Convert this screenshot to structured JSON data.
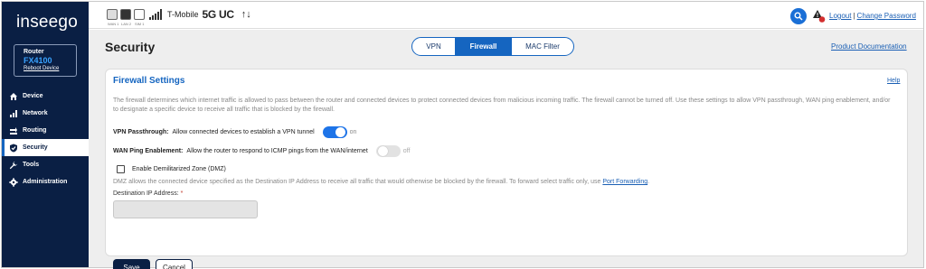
{
  "sidebar": {
    "logo": "inseego",
    "router_label": "Router",
    "router_model": "FX4100",
    "reboot_label": "Reboot Device",
    "items": [
      {
        "label": "Device",
        "icon": "home-icon"
      },
      {
        "label": "Network",
        "icon": "signal-bars-icon"
      },
      {
        "label": "Routing",
        "icon": "routing-icon"
      },
      {
        "label": "Security",
        "icon": "shield-icon",
        "active": true
      },
      {
        "label": "Tools",
        "icon": "wrench-icon"
      },
      {
        "label": "Administration",
        "icon": "gear-icon"
      }
    ]
  },
  "topbar": {
    "status_icon_labels": [
      "WAN 1",
      "LAN 2",
      "SIM 1"
    ],
    "carrier": "T-Mobile",
    "network_type": "5G UC",
    "data_arrows": "↑↓",
    "logout_label": "Logout",
    "separator": "|",
    "change_password_label": "Change Password"
  },
  "page": {
    "title": "Security",
    "tabs": [
      {
        "label": "VPN",
        "active": false
      },
      {
        "label": "Firewall",
        "active": true
      },
      {
        "label": "MAC Filter",
        "active": false
      }
    ],
    "product_doc_label": "Product Documentation"
  },
  "firewall": {
    "title": "Firewall Settings",
    "help_label": "Help",
    "description": "The firewall determines which internet traffic is allowed to pass between the router and connected devices to protect connected devices from malicious incoming traffic. The firewall cannot be turned off. Use these settings to allow VPN passthrough, WAN ping enablement, and/or to designate a specific device to receive all traffic that is blocked by the firewall.",
    "vpn_passthrough": {
      "label": "VPN Passthrough:",
      "desc": "Allow connected devices to establish a VPN tunnel",
      "state": "on"
    },
    "wan_ping": {
      "label": "WAN Ping Enablement:",
      "desc": "Allow the router to respond to ICMP pings from the WAN/internet",
      "state": "off"
    },
    "dmz": {
      "checkbox_label": "Enable Demilitarized Zone (DMZ)",
      "checked": false,
      "desc": "DMZ allows the connected device specified as the Destination IP Address to receive all traffic that would otherwise be blocked by the firewall. To forward select traffic only, use",
      "link_label": "Port Forwarding",
      "period": ".",
      "ip_label": "Destination IP Address:",
      "required_mark": "*",
      "ip_value": ""
    },
    "save_label": "Save",
    "cancel_label": "Cancel"
  },
  "colors": {
    "sidebar_bg": "#0a1f44",
    "accent": "#1565c0",
    "toggle_on": "#1e74e8"
  }
}
